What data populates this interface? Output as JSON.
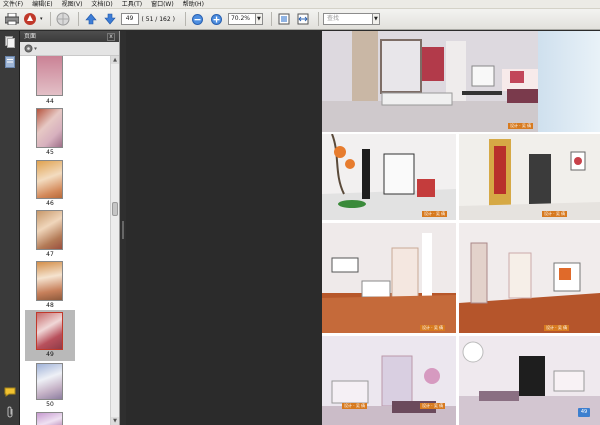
{
  "menu": [
    "文件(F)",
    "编辑(E)",
    "视图(V)",
    "文档(D)",
    "工具(T)",
    "窗口(W)",
    "帮助(H)"
  ],
  "toolbar": {
    "current_page": "49",
    "page_count": "( 51 / 162 )",
    "zoom": "70.2%",
    "search_placeholder": "查找"
  },
  "panel": {
    "title": "页面",
    "close_label": "x",
    "thumbnails": [
      {
        "label": "44",
        "selected": false
      },
      {
        "label": "45",
        "selected": false
      },
      {
        "label": "46",
        "selected": false
      },
      {
        "label": "47",
        "selected": false
      },
      {
        "label": "48",
        "selected": false
      },
      {
        "label": "49",
        "selected": true
      },
      {
        "label": "50",
        "selected": false
      }
    ]
  },
  "document": {
    "captions": [
      "设计 · 吴 倩",
      "设计 · 吴 倩",
      "设计 · 吴 倩",
      "设计 · 吴 倩",
      "设计 · 吴 倩",
      "设计 · 吴 倩",
      "设计 · 吴 倩"
    ],
    "page_number": "49"
  },
  "colors": {
    "caption_bg": "#d77a1f",
    "page_badge": "#3c7fcf"
  }
}
